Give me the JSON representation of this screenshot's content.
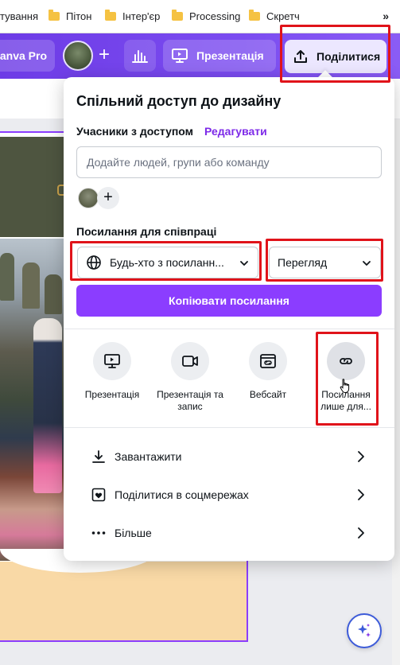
{
  "bookmarks": {
    "items": [
      {
        "label": "тування"
      },
      {
        "label": "Пітон"
      },
      {
        "label": "Інтер'єр"
      },
      {
        "label": "Processing"
      },
      {
        "label": "Скретч"
      }
    ],
    "more": "»"
  },
  "toolbar": {
    "pro_label": "anva Pro",
    "present_label": "Презентація",
    "share_label": "Поділитися"
  },
  "share_panel": {
    "title": "Спільний доступ до дизайну",
    "members_label": "Учасники з доступом",
    "edit_link": "Редагувати",
    "people_input_placeholder": "Додайте людей, групи або команду",
    "collab_link_label": "Посилання для співпраці",
    "access_select_value": "Будь-хто з посиланн...",
    "permission_select_value": "Перегляд",
    "copy_link_button": "Копіювати посилання",
    "options": [
      {
        "label": "Презентація",
        "icon": "presentation-icon"
      },
      {
        "label": "Презентація та запис",
        "icon": "video-camera-icon"
      },
      {
        "label": "Вебсайт",
        "icon": "website-icon"
      },
      {
        "label": "Посилання лише для...",
        "icon": "link-icon"
      }
    ],
    "rows": [
      {
        "label": "Завантажити",
        "icon": "download-icon"
      },
      {
        "label": "Поділитися в соцмережах",
        "icon": "heart-icon"
      },
      {
        "label": "Більше",
        "icon": "more-dots-icon"
      }
    ]
  },
  "colors": {
    "accent": "#8b3dff",
    "highlight": "#e0131a"
  }
}
